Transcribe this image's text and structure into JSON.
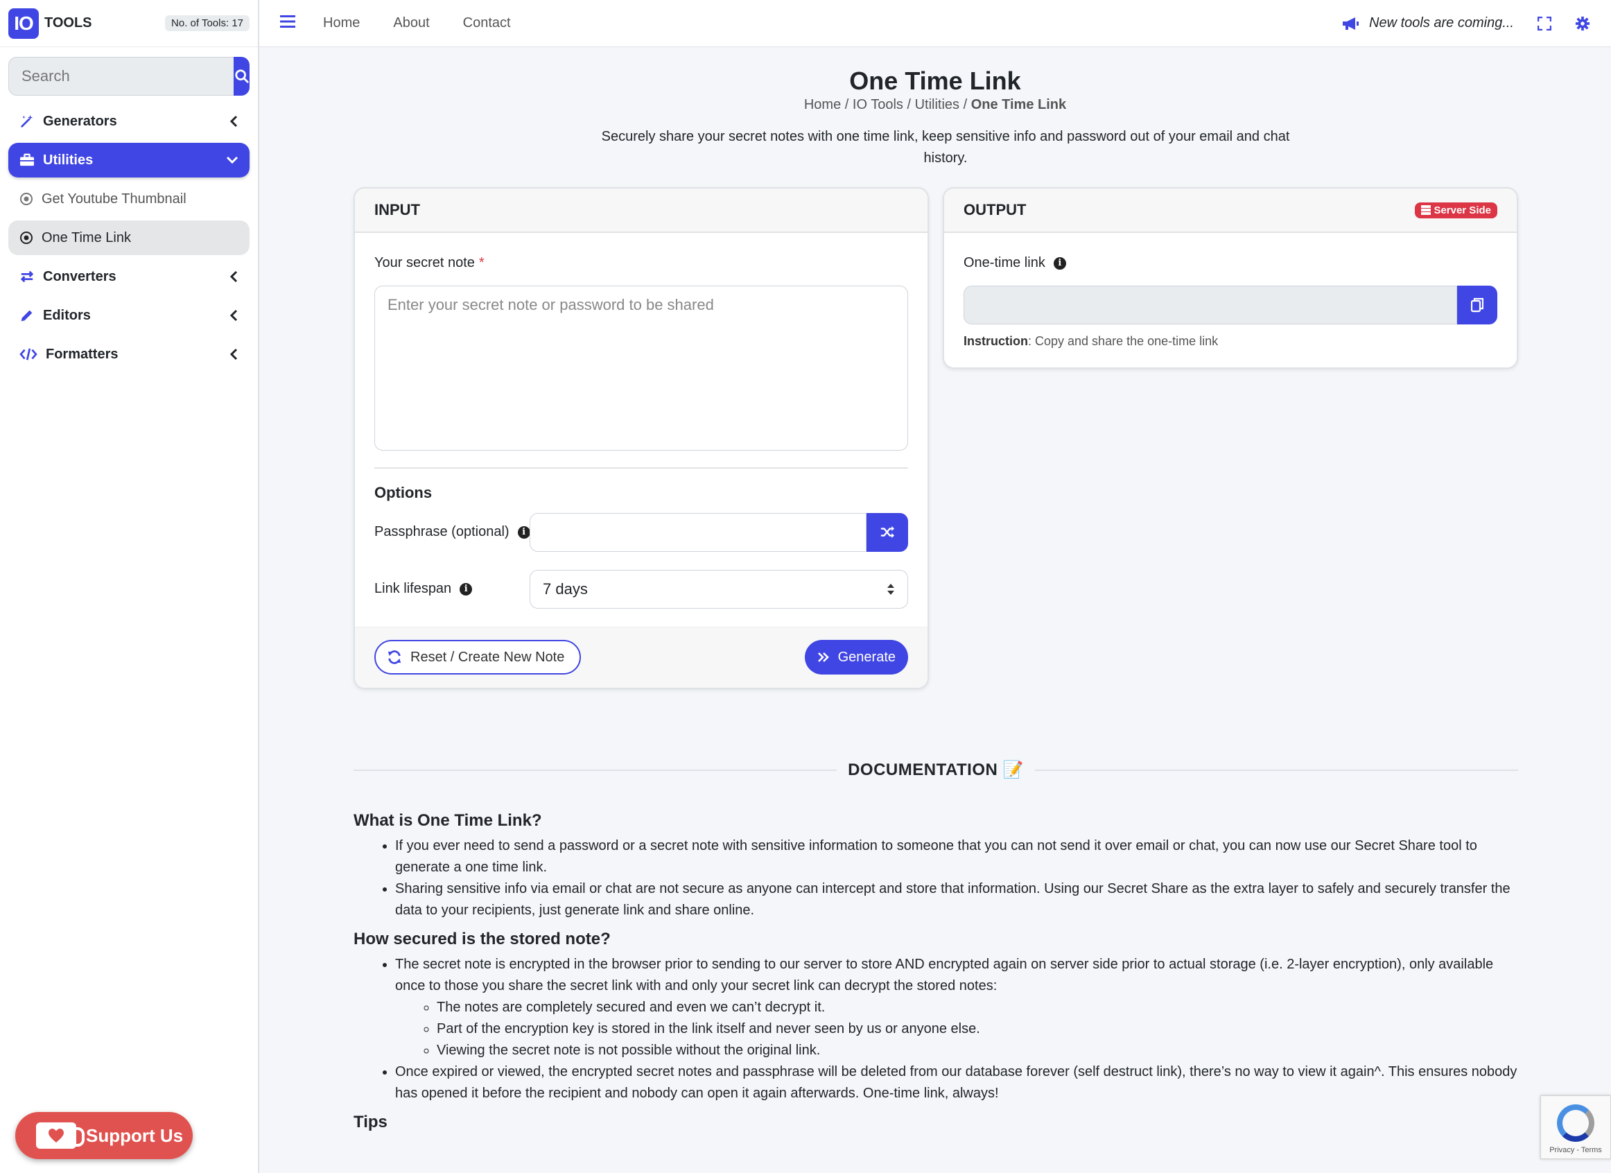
{
  "brand": {
    "logo": "IO",
    "name": "TOOLS",
    "tool_count": "No. of Tools: 17"
  },
  "search": {
    "placeholder": "Search"
  },
  "sidebar": {
    "items": [
      {
        "label": "Generators",
        "icon": "magic-wand-icon"
      },
      {
        "label": "Utilities",
        "icon": "toolbox-icon"
      },
      {
        "label": "Get Youtube Thumbnail",
        "icon": "circle-dot-icon"
      },
      {
        "label": "One Time Link",
        "icon": "circle-dot-icon"
      },
      {
        "label": "Converters",
        "icon": "arrows-exchange-icon"
      },
      {
        "label": "Editors",
        "icon": "pencil-icon"
      },
      {
        "label": "Formatters",
        "icon": "code-icon"
      }
    ],
    "support_label": "Support Us"
  },
  "topbar": {
    "links": [
      "Home",
      "About",
      "Contact"
    ],
    "announcement": "New tools are coming..."
  },
  "page": {
    "title": "One Time Link",
    "breadcrumb": {
      "home": "Home",
      "sep": " / ",
      "io": "IO Tools",
      "cat": "Utilities",
      "current": "One Time Link"
    },
    "description": "Securely share your secret notes with one time link, keep sensitive info and password out of your email and chat history."
  },
  "input_card": {
    "header": "INPUT",
    "note_label": "Your secret note",
    "note_required": "*",
    "note_placeholder": "Enter your secret note or password to be shared",
    "options_title": "Options",
    "passphrase_label": "Passphrase (optional)",
    "lifespan_label": "Link lifespan",
    "lifespan_value": "7 days",
    "reset_label": "Reset / Create New Note",
    "generate_label": "Generate"
  },
  "output_card": {
    "header": "OUTPUT",
    "badge": "Server Side",
    "link_label": "One-time link",
    "instruction_bold": "Instruction",
    "instruction_text": ": Copy and share the one-time link"
  },
  "docs": {
    "heading": "DOCUMENTATION 📝",
    "s1_title": "What is One Time Link?",
    "s1_items": [
      "If you ever need to send a password or a secret note with sensitive information to someone that you can not send it over email or chat, you can now use our Secret Share tool to generate a one time link.",
      "Sharing sensitive info via email or chat are not secure as anyone can intercept and store that information. Using our Secret Share as the extra layer to safely and securely transfer the data to your recipients, just generate link and share online."
    ],
    "s2_title": "How secured is the stored note?",
    "s2_item1": "The secret note is encrypted in the browser prior to sending to our server to store AND encrypted again on server side prior to actual storage (i.e. 2-layer encryption), only available once to those you share the secret link with and only your secret link can decrypt the stored notes:",
    "s2_sub": [
      "The notes are completely secured and even we can’t decrypt it.",
      "Part of the encryption key is stored in the link itself and never seen by us or anyone else.",
      "Viewing the secret note is not possible without the original link."
    ],
    "s2_item2": "Once expired or viewed, the encrypted secret notes and passphrase will be deleted from our database forever (self destruct link), there’s no way to view it again^. This ensures nobody has opened it before the recipient and nobody can open it again afterwards. One-time link, always!",
    "s3_title": "Tips"
  },
  "recaptcha": {
    "text": "Privacy - Terms"
  },
  "colors": {
    "accent": "#4046e3",
    "danger": "#dc3545",
    "support": "#e0524f"
  }
}
